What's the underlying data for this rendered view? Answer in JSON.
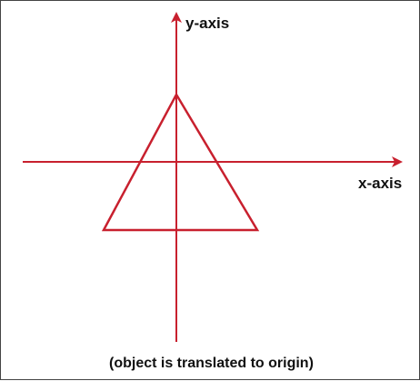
{
  "labels": {
    "y_axis": "y-axis",
    "x_axis": "x-axis",
    "caption": "(object is translated to origin)"
  },
  "colors": {
    "stroke": "#c8202e",
    "text": "#111111",
    "border": "#444444",
    "background": "#ffffff"
  }
}
